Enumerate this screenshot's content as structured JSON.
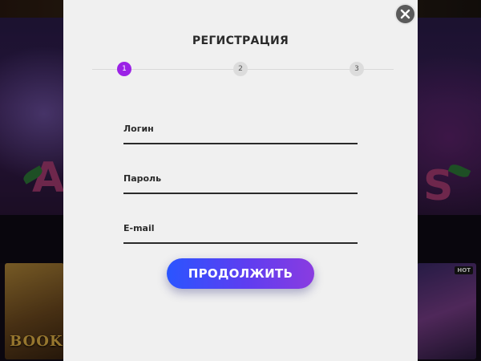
{
  "modal": {
    "title": "РЕГИСТРАЦИЯ",
    "steps": [
      {
        "label": "1",
        "active": true
      },
      {
        "label": "2",
        "active": false
      },
      {
        "label": "3",
        "active": false
      }
    ],
    "fields": {
      "login": {
        "label": "Логин",
        "value": ""
      },
      "password": {
        "label": "Пароль",
        "value": ""
      },
      "email": {
        "label": "E-mail",
        "value": ""
      }
    },
    "continue_label": "ПРОДОЛЖИТЬ",
    "close_icon": "close-icon"
  },
  "background": {
    "hot_badge": "HOT",
    "left_game_text": "BOOK"
  },
  "colors": {
    "modal_bg": "#f0f0f0",
    "step_active": "#9b22e6",
    "step_inactive": "#dcdcdc",
    "button_gradient_start": "#2a55ff",
    "button_gradient_end": "#8a3ce0",
    "close_button": "#5a5a5a"
  }
}
